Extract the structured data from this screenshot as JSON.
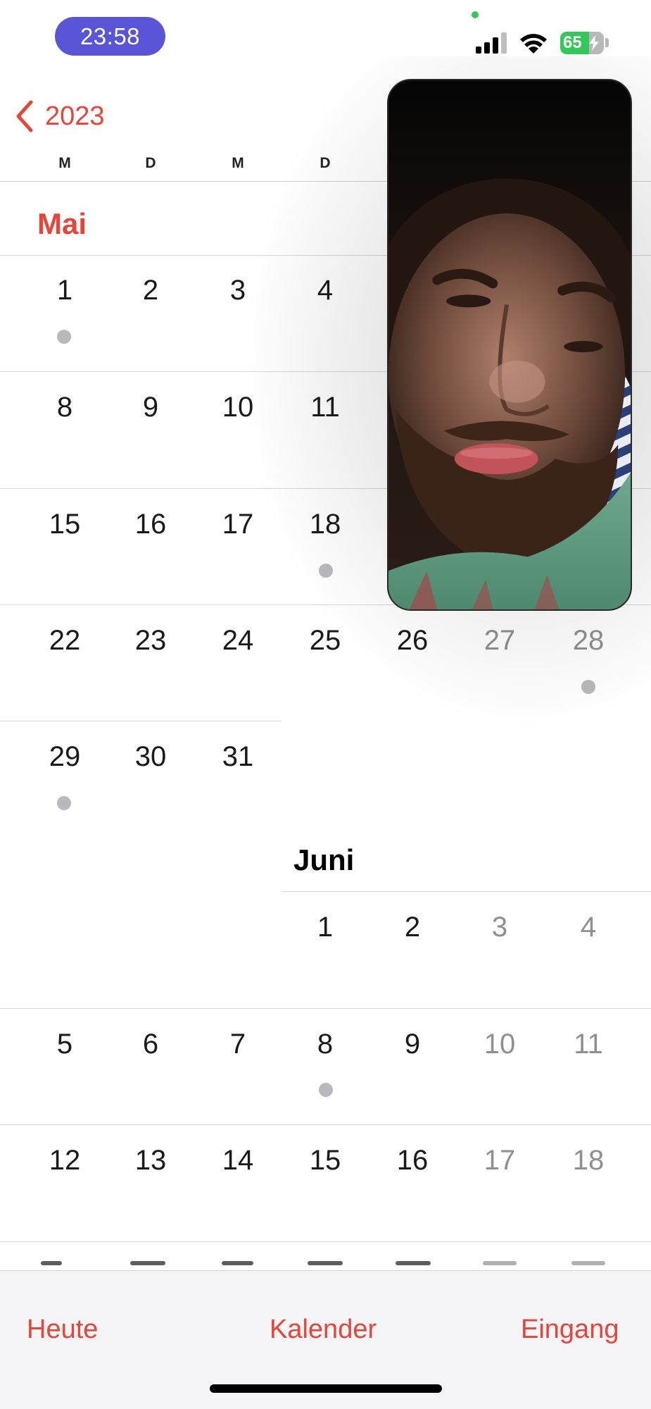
{
  "status_bar": {
    "time": "23:58",
    "battery_level": "65",
    "signal_icon": "cellular-signal-icon",
    "wifi_icon": "wifi-icon",
    "battery_icon": "battery-charging-icon",
    "camera_indicator_color": "#34c759"
  },
  "header": {
    "back_label": "2023",
    "back_icon": "chevron-left-icon",
    "weekdays": [
      "M",
      "D",
      "M",
      "D"
    ]
  },
  "months": [
    {
      "name": "Mai",
      "weeks": [
        [
          "1",
          "2",
          "3",
          "4"
        ],
        [
          "8",
          "9",
          "10",
          "11"
        ],
        [
          "15",
          "16",
          "17",
          "18"
        ],
        [
          "22",
          "23",
          "24",
          "25",
          "26",
          "27",
          "28"
        ],
        [
          "29",
          "30",
          "31"
        ]
      ]
    },
    {
      "name": "Juni",
      "weeks": [
        [
          "1",
          "2",
          "3",
          "4"
        ],
        [
          "5",
          "6",
          "7",
          "8",
          "9",
          "10",
          "11"
        ],
        [
          "12",
          "13",
          "14",
          "15",
          "16",
          "17",
          "18"
        ]
      ]
    }
  ],
  "event_dot_days": [
    "1. Mai",
    "18. Mai",
    "28. Mai",
    "29. Mai",
    "8. Juni"
  ],
  "video_overlay": {
    "icon": "facetime-video-pip"
  },
  "tab_bar": {
    "today": "Heute",
    "calendars": "Kalender",
    "inbox": "Eingang"
  },
  "colors": {
    "accent": "#e8443a",
    "time_pill": "#5a55d6",
    "battery": "#34c759",
    "weekend_text": "#8e8e93",
    "event_dot": "#b9b9bd"
  }
}
